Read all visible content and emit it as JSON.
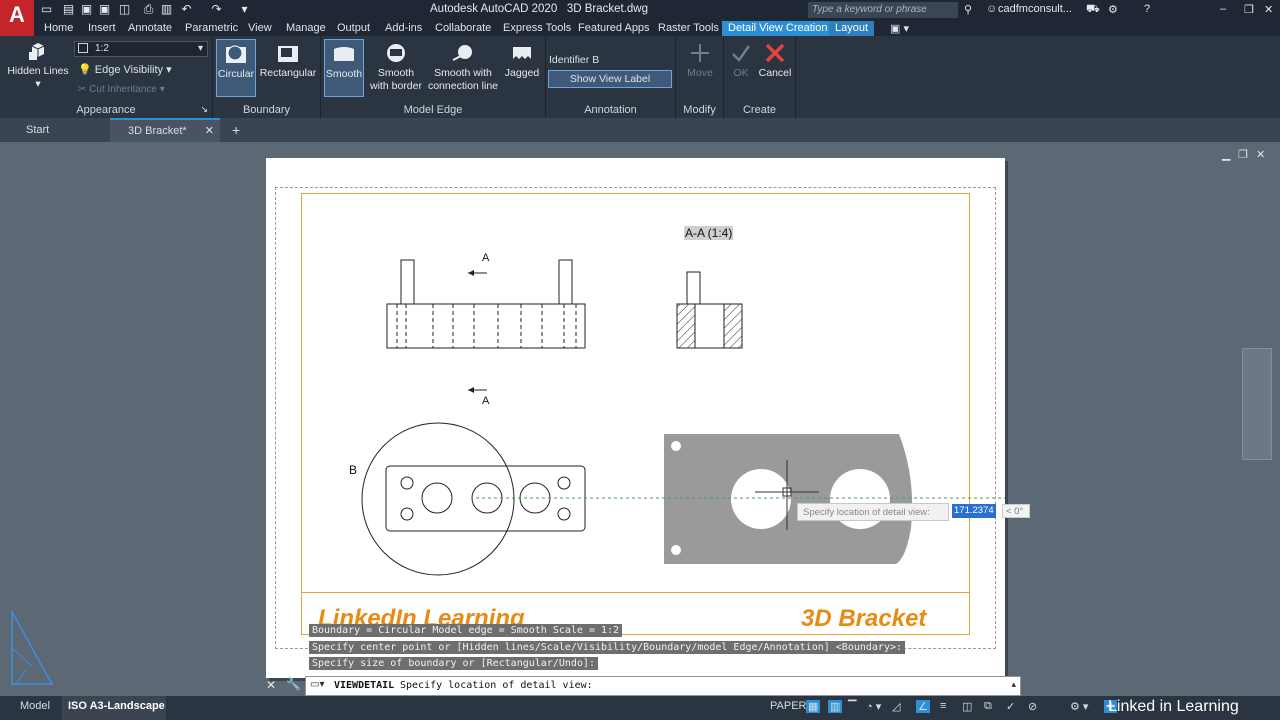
{
  "titlebar": {
    "title": "Autodesk AutoCAD 2020",
    "filename": "3D Bracket.dwg",
    "search_placeholder": "Type a keyword or phrase",
    "user": "cadfmconsult..."
  },
  "ribbon_tabs": [
    "Home",
    "Insert",
    "Annotate",
    "Parametric",
    "View",
    "Manage",
    "Output",
    "Add-ins",
    "Collaborate",
    "Express Tools",
    "Featured Apps",
    "Raster Tools",
    "Detail View Creation",
    "Layout"
  ],
  "panels": {
    "appearance": {
      "label": "Appearance",
      "hidden_lines": "Hidden Lines",
      "scale": "1:2",
      "edge_visibility": "Edge Visibility",
      "cut_inheritance": "Cut Inheritance"
    },
    "boundary": {
      "label": "Boundary",
      "circular": "Circular",
      "rectangular": "Rectangular"
    },
    "model_edge": {
      "label": "Model Edge",
      "smooth": "Smooth",
      "smooth_border_1": "Smooth",
      "smooth_border_2": "with border",
      "smooth_conn_1": "Smooth with",
      "smooth_conn_2": "connection line",
      "jagged": "Jagged"
    },
    "annotation": {
      "label": "Annotation",
      "identifier": "Identifier B",
      "show_view_label": "Show View Label"
    },
    "modify": {
      "label": "Modify",
      "move": "Move"
    },
    "create": {
      "label": "Create",
      "ok": "OK",
      "cancel": "Cancel"
    }
  },
  "doc_tabs": {
    "start": "Start",
    "active": "3D Bracket*"
  },
  "drawing": {
    "section_label": "A-A (1:4)",
    "marker_a_top": "A",
    "marker_a_bottom": "A",
    "detail_label": "B",
    "titleblock_left": "LinkedIn Learning",
    "titleblock_right": "3D Bracket"
  },
  "tooltip": {
    "prompt": "Specify location of detail view:",
    "value": "171.2374",
    "angle": "< 0°"
  },
  "command_history": [
    "Boundary = Circular  Model edge = Smooth  Scale = 1:2",
    "Specify center point or [Hidden lines/Scale/Visibility/Boundary/model Edge/Annotation] <Boundary>:",
    "Specify size of boundary or [Rectangular/Undo]:"
  ],
  "command_line": {
    "command": "VIEWDETAIL",
    "prompt": "Specify location of detail view:"
  },
  "status": {
    "model_tab": "Model",
    "layout_tab": "ISO A3-Landscape",
    "paper": "PAPER",
    "brand": "Linked in Learning"
  },
  "colors": {
    "ribbon": "#2b3441",
    "accent": "#2d8fd6",
    "titleblock": "#e88a14"
  }
}
